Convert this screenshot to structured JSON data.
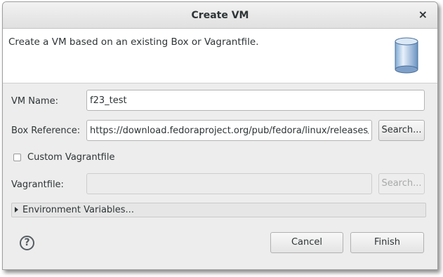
{
  "dialog": {
    "title": "Create VM",
    "close_glyph": "×",
    "description": "Create a VM based on an existing Box or Vagrantfile.",
    "banner_icon": "database-cylinder-icon"
  },
  "form": {
    "vm_name_label": "VM Name:",
    "vm_name_value": "f23_test",
    "box_reference_label": "Box Reference:",
    "box_reference_value": "https://download.fedoraproject.org/pub/fedora/linux/releases/",
    "search_label": "Search...",
    "custom_vagrantfile_label": "Custom Vagrantfile",
    "custom_vagrantfile_checked": false,
    "vagrantfile_label": "Vagrantfile:",
    "vagrantfile_value": "",
    "vagrantfile_search_label": "Search...",
    "env_vars_label": "Environment Variables..."
  },
  "footer": {
    "help_glyph": "?",
    "cancel_label": "Cancel",
    "finish_label": "Finish"
  }
}
